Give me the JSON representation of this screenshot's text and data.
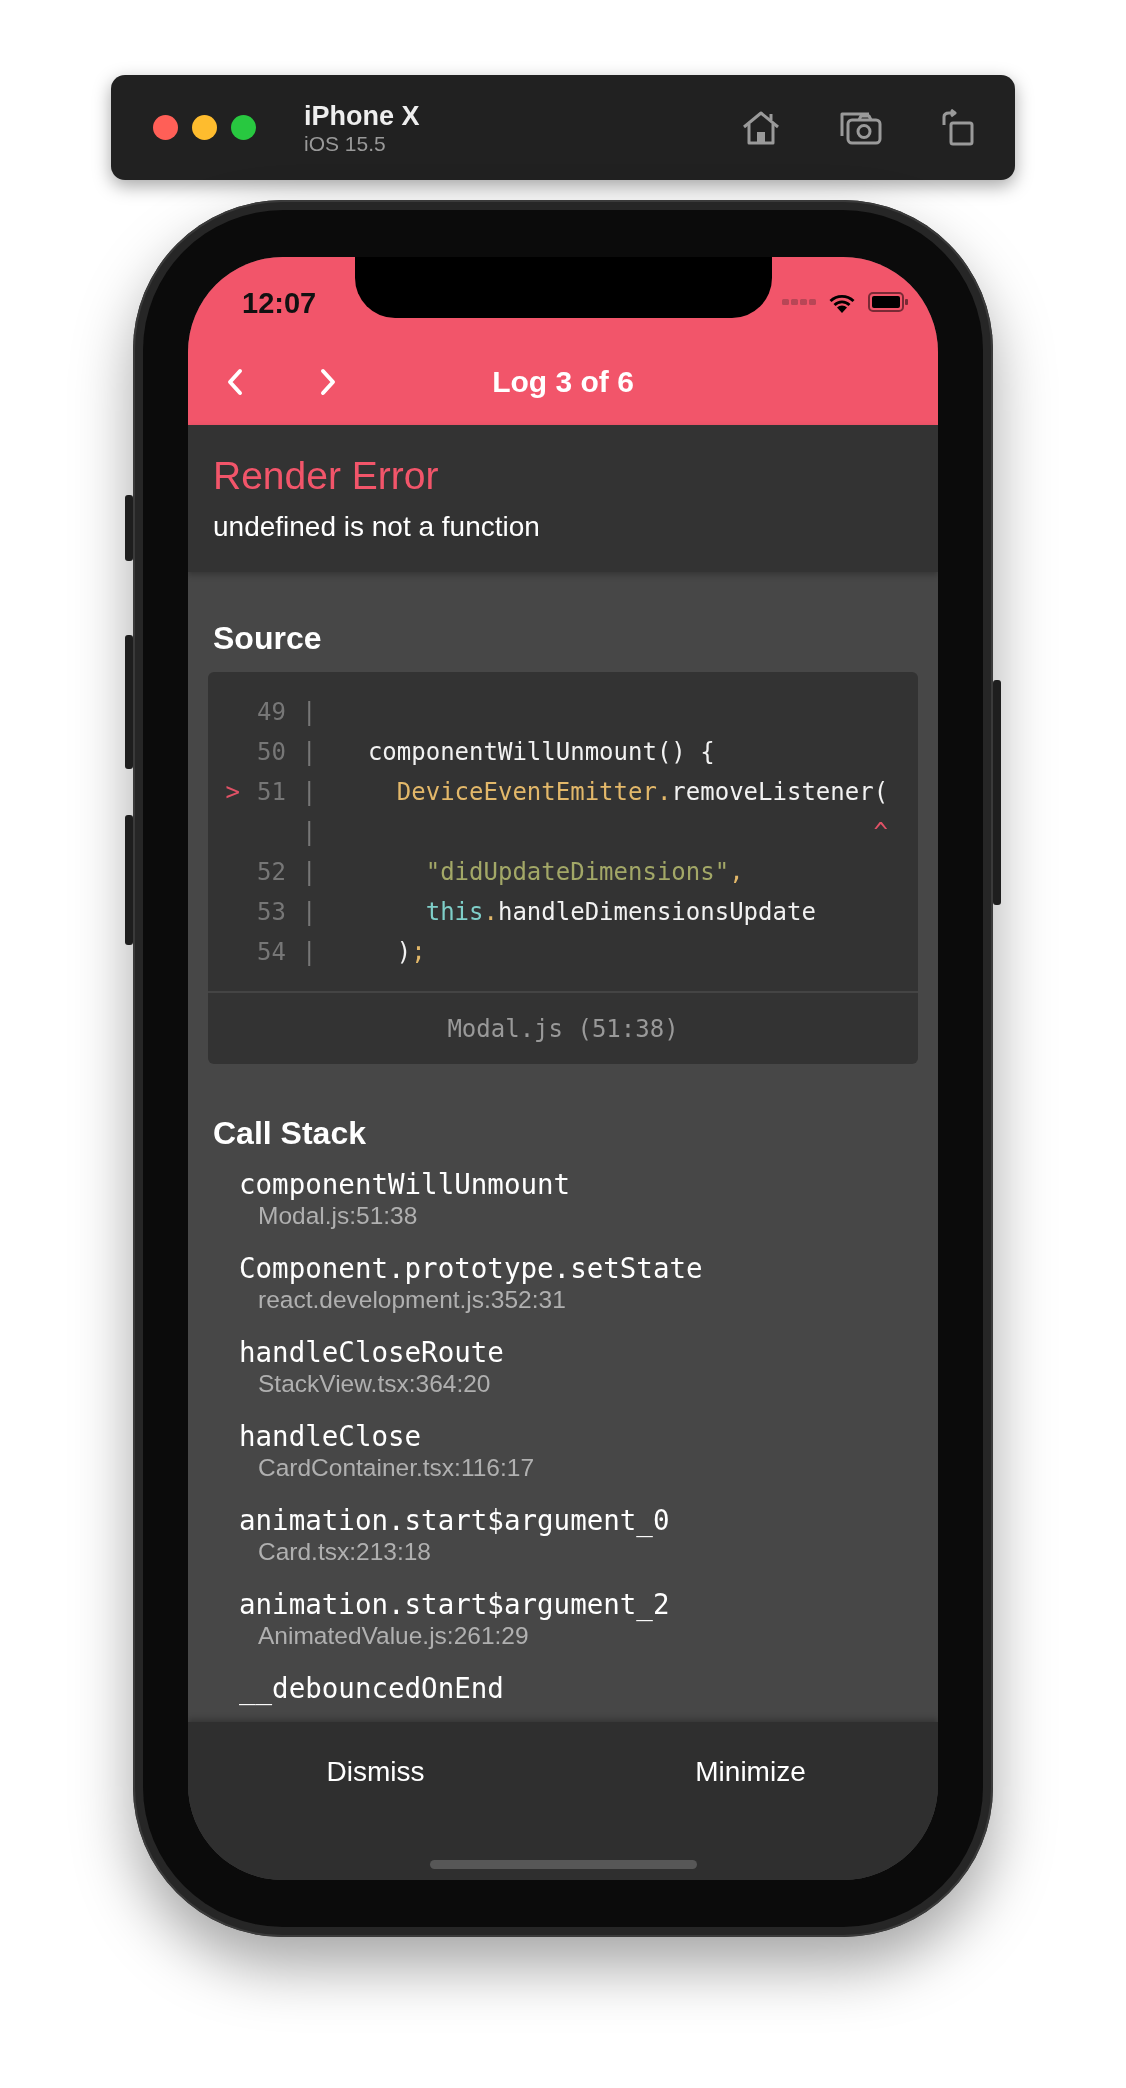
{
  "simulator": {
    "device": "iPhone X",
    "os": "iOS 15.5"
  },
  "status_bar": {
    "time": "12:07"
  },
  "header": {
    "title": "Log 3 of 6"
  },
  "error": {
    "type": "Render Error",
    "message": "undefined is not a function"
  },
  "source": {
    "heading": "Source",
    "lines": [
      {
        "number": "49",
        "gutter": "|"
      },
      {
        "number": "50",
        "gutter": "|",
        "tokens": [
          {
            "kind": "plain",
            "text": "  componentWillUnmount() {"
          }
        ]
      },
      {
        "marker": ">",
        "number": "51",
        "gutter": "|",
        "tokens": [
          {
            "kind": "type",
            "text": "    DeviceEventEmitter."
          },
          {
            "kind": "plain",
            "text": "removeListener("
          }
        ]
      },
      {
        "gutter": "|",
        "tokens": [
          {
            "kind": "caret",
            "text": "                                     ^"
          }
        ]
      },
      {
        "number": "52",
        "gutter": "|",
        "tokens": [
          {
            "kind": "string",
            "text": "      \"didUpdateDimensions\""
          },
          {
            "kind": "type",
            "text": ","
          }
        ]
      },
      {
        "number": "53",
        "gutter": "|",
        "tokens": [
          {
            "kind": "keyword",
            "text": "      this"
          },
          {
            "kind": "type",
            "text": "."
          },
          {
            "kind": "plain",
            "text": "handleDimensionsUpdate"
          }
        ]
      },
      {
        "number": "54",
        "gutter": "|",
        "tokens": [
          {
            "kind": "plain",
            "text": "    )"
          },
          {
            "kind": "type",
            "text": ";"
          }
        ]
      }
    ],
    "location": "Modal.js (51:38)"
  },
  "call_stack": {
    "heading": "Call Stack",
    "frames": [
      {
        "method": "componentWillUnmount",
        "location": "Modal.js:51:38"
      },
      {
        "method": "Component.prototype.setState",
        "location": "react.development.js:352:31"
      },
      {
        "method": "handleCloseRoute",
        "location": "StackView.tsx:364:20"
      },
      {
        "method": "handleClose",
        "location": "CardContainer.tsx:116:17"
      },
      {
        "method": "animation.start$argument_0",
        "location": "Card.tsx:213:18"
      },
      {
        "method": "animation.start$argument_2",
        "location": "AnimatedValue.js:261:29"
      },
      {
        "method": "__debouncedOnEnd"
      }
    ]
  },
  "footer": {
    "buttons": [
      "Dismiss",
      "Minimize"
    ]
  }
}
